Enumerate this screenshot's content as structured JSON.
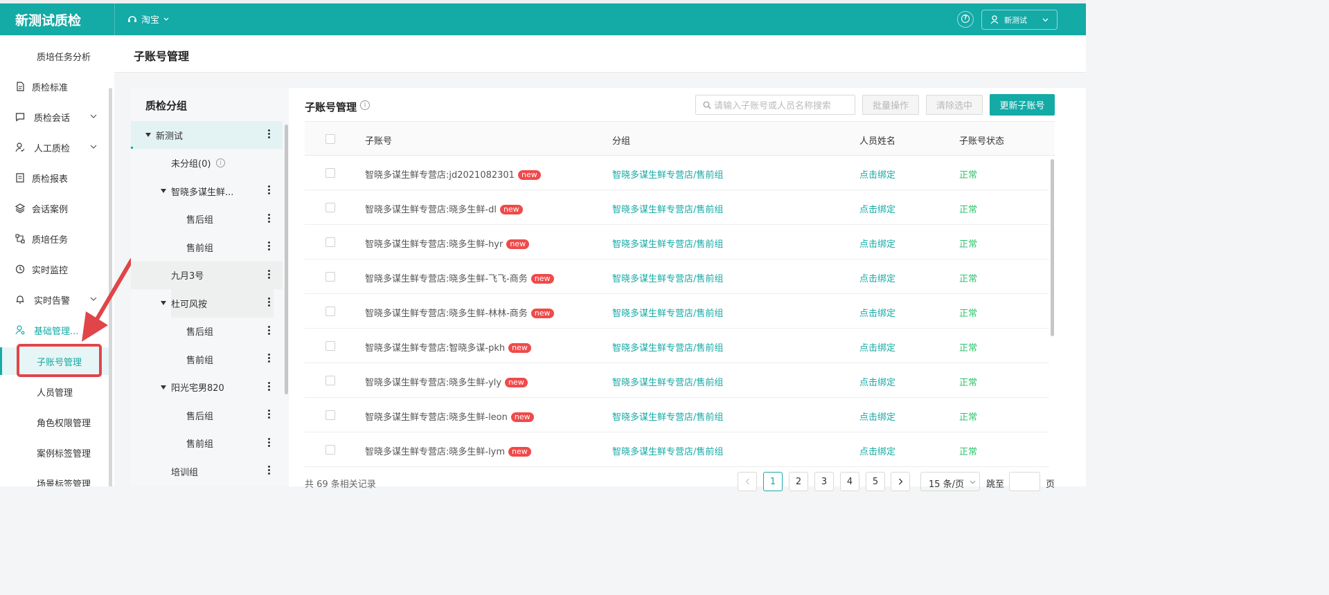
{
  "header": {
    "brand": "新测试质检",
    "shop": "淘宝",
    "user": "新测试"
  },
  "sidebar": {
    "items": [
      {
        "label": "质培任务分析",
        "icon": "chart-icon",
        "sub": true
      },
      {
        "label": "质检标准",
        "icon": "document-icon"
      },
      {
        "label": "质检会话",
        "icon": "chat-icon",
        "expand": true
      },
      {
        "label": "人工质检",
        "icon": "user-check-icon",
        "expand": true
      },
      {
        "label": "质检报表",
        "icon": "report-icon"
      },
      {
        "label": "会话案例",
        "icon": "layers-icon"
      },
      {
        "label": "质培任务",
        "icon": "flow-icon"
      },
      {
        "label": "实时监控",
        "icon": "clock-icon"
      },
      {
        "label": "实时告警",
        "icon": "bell-icon",
        "expand": true
      },
      {
        "label": "基础管理...",
        "icon": "user-gear-icon",
        "expand": true,
        "open": true
      },
      {
        "label": "子账号管理",
        "sub": true,
        "active": true
      },
      {
        "label": "人员管理",
        "sub": true
      },
      {
        "label": "角色权限管理",
        "sub": true
      },
      {
        "label": "案例标签管理",
        "sub": true
      },
      {
        "label": "场景标签管理",
        "sub": true
      }
    ]
  },
  "page": {
    "title": "子账号管理"
  },
  "groups": {
    "title": "质检分组",
    "nodes": [
      {
        "label": "新测试",
        "level": 0,
        "expanded": true,
        "more": true,
        "selected": true
      },
      {
        "label": "未分组(0)",
        "level": 1,
        "info": true
      },
      {
        "label": "智晓多谋生鲜...",
        "level": 1,
        "expanded": true,
        "more": true
      },
      {
        "label": "售后组",
        "level": 2,
        "more": true
      },
      {
        "label": "售前组",
        "level": 2,
        "more": true
      },
      {
        "label": "九月3号",
        "level": 1,
        "more": true,
        "hover": true
      },
      {
        "label": "杜可风按",
        "level": 1,
        "expanded": true,
        "more": true,
        "hoverLabel": true
      },
      {
        "label": "售后组",
        "level": 2,
        "more": true
      },
      {
        "label": "售前组",
        "level": 2,
        "more": true
      },
      {
        "label": "阳光宅男820",
        "level": 1,
        "expanded": true,
        "more": true
      },
      {
        "label": "售后组",
        "level": 2,
        "more": true
      },
      {
        "label": "售前组",
        "level": 2,
        "more": true
      },
      {
        "label": "培训组",
        "level": 1,
        "more": true
      }
    ]
  },
  "main": {
    "title": "子账号管理",
    "search_placeholder": "请输入子账号或人员名称搜索",
    "batch_label": "批量操作",
    "clear_label": "清除选中",
    "update_label": "更新子账号",
    "columns": [
      "子账号",
      "分组",
      "人员姓名",
      "子账号状态"
    ],
    "badge": "new",
    "rows": [
      {
        "account": "智晓多谋生鲜专营店:jd2021082301",
        "group": "智晓多谋生鲜专营店/售前组",
        "person": "点击绑定",
        "status": "正常"
      },
      {
        "account": "智晓多谋生鲜专营店:晓多生鲜-dl",
        "group": "智晓多谋生鲜专营店/售前组",
        "person": "点击绑定",
        "status": "正常"
      },
      {
        "account": "智晓多谋生鲜专营店:晓多生鲜-hyr",
        "group": "智晓多谋生鲜专营店/售前组",
        "person": "点击绑定",
        "status": "正常"
      },
      {
        "account": "智晓多谋生鲜专营店:晓多生鲜-飞飞-商务",
        "group": "智晓多谋生鲜专营店/售前组",
        "person": "点击绑定",
        "status": "正常"
      },
      {
        "account": "智晓多谋生鲜专营店:晓多生鲜-林林-商务",
        "group": "智晓多谋生鲜专营店/售前组",
        "person": "点击绑定",
        "status": "正常"
      },
      {
        "account": "智晓多谋生鲜专营店:智晓多谋-pkh",
        "group": "智晓多谋生鲜专营店/售前组",
        "person": "点击绑定",
        "status": "正常"
      },
      {
        "account": "智晓多谋生鲜专营店:晓多生鲜-yly",
        "group": "智晓多谋生鲜专营店/售前组",
        "person": "点击绑定",
        "status": "正常"
      },
      {
        "account": "智晓多谋生鲜专营店:晓多生鲜-leon",
        "group": "智晓多谋生鲜专营店/售前组",
        "person": "点击绑定",
        "status": "正常"
      },
      {
        "account": "智晓多谋生鲜专营店:晓多生鲜-lym",
        "group": "智晓多谋生鲜专营店/售前组",
        "person": "点击绑定",
        "status": "正常"
      }
    ]
  },
  "pagination": {
    "total_text": "共 69 条相关记录",
    "pages": [
      "1",
      "2",
      "3",
      "4",
      "5"
    ],
    "current": "1",
    "page_size": "15 条/页",
    "jump_prefix": "跳至",
    "jump_suffix": "页"
  },
  "colors": {
    "accent": "#14aaa6",
    "ok": "#2ec36b",
    "badge": "#f04a4a",
    "highlight": "#e0454a"
  }
}
